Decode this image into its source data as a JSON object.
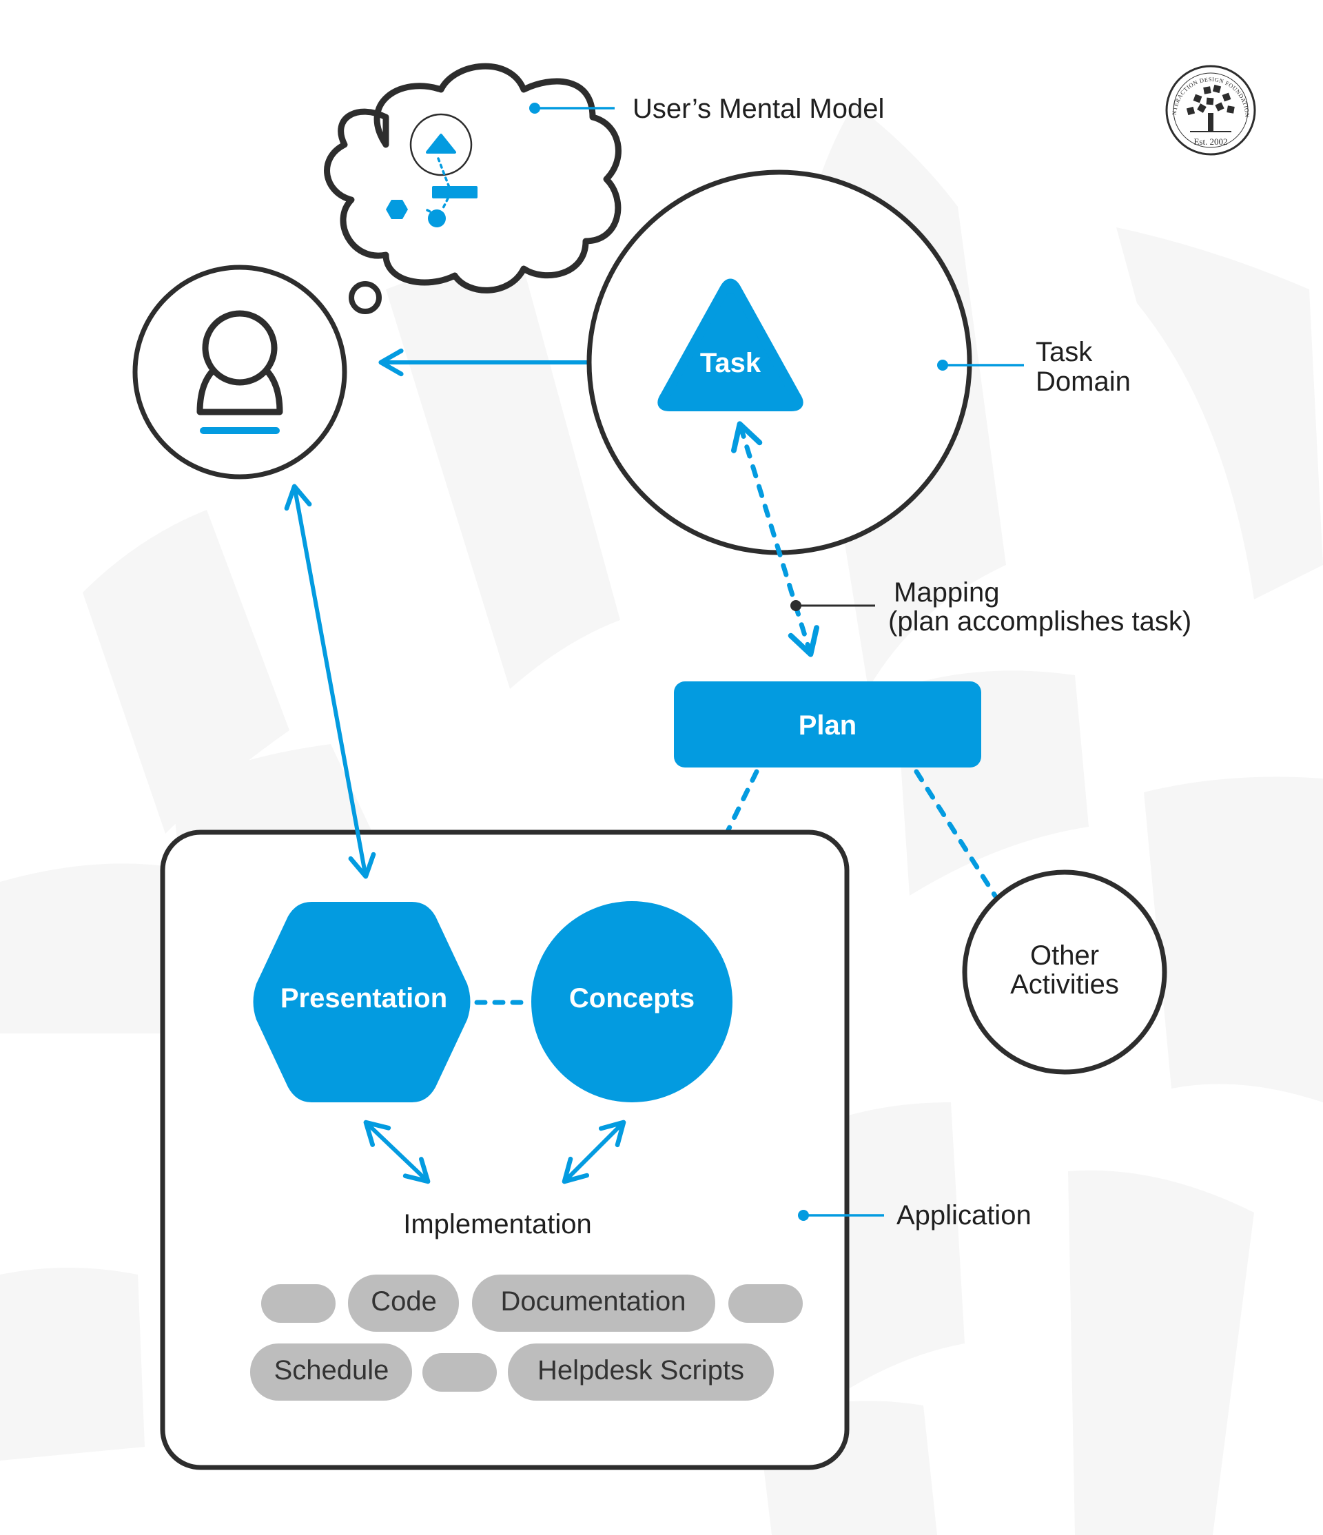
{
  "colors": {
    "accent": "#039be0",
    "stroke": "#2d2d2d",
    "pill": "#bdbdbd",
    "background_shapes": "#f6f6f6"
  },
  "logo": {
    "ring_text": "INTERACTION DESIGN FOUNDATION",
    "established": "Est. 2002"
  },
  "annotations": {
    "mental_model": "User’s Mental Model",
    "task_domain_line1": "Task",
    "task_domain_line2": "Domain",
    "mapping_line1": "Mapping",
    "mapping_line2": "(plan accomplishes task)",
    "application": "Application"
  },
  "nodes": {
    "user": {
      "icon": "user-icon"
    },
    "task": {
      "label": "Task"
    },
    "plan": {
      "label": "Plan"
    },
    "other_line1": "Other",
    "other_line2": "Activities",
    "presentation": {
      "label": "Presentation"
    },
    "concepts": {
      "label": "Concepts"
    },
    "implementation": "Implementation"
  },
  "implementation_items": {
    "row1": [
      "",
      "Code",
      "Documentation",
      ""
    ],
    "row2": [
      "Schedule",
      "",
      "Helpdesk Scripts"
    ]
  }
}
